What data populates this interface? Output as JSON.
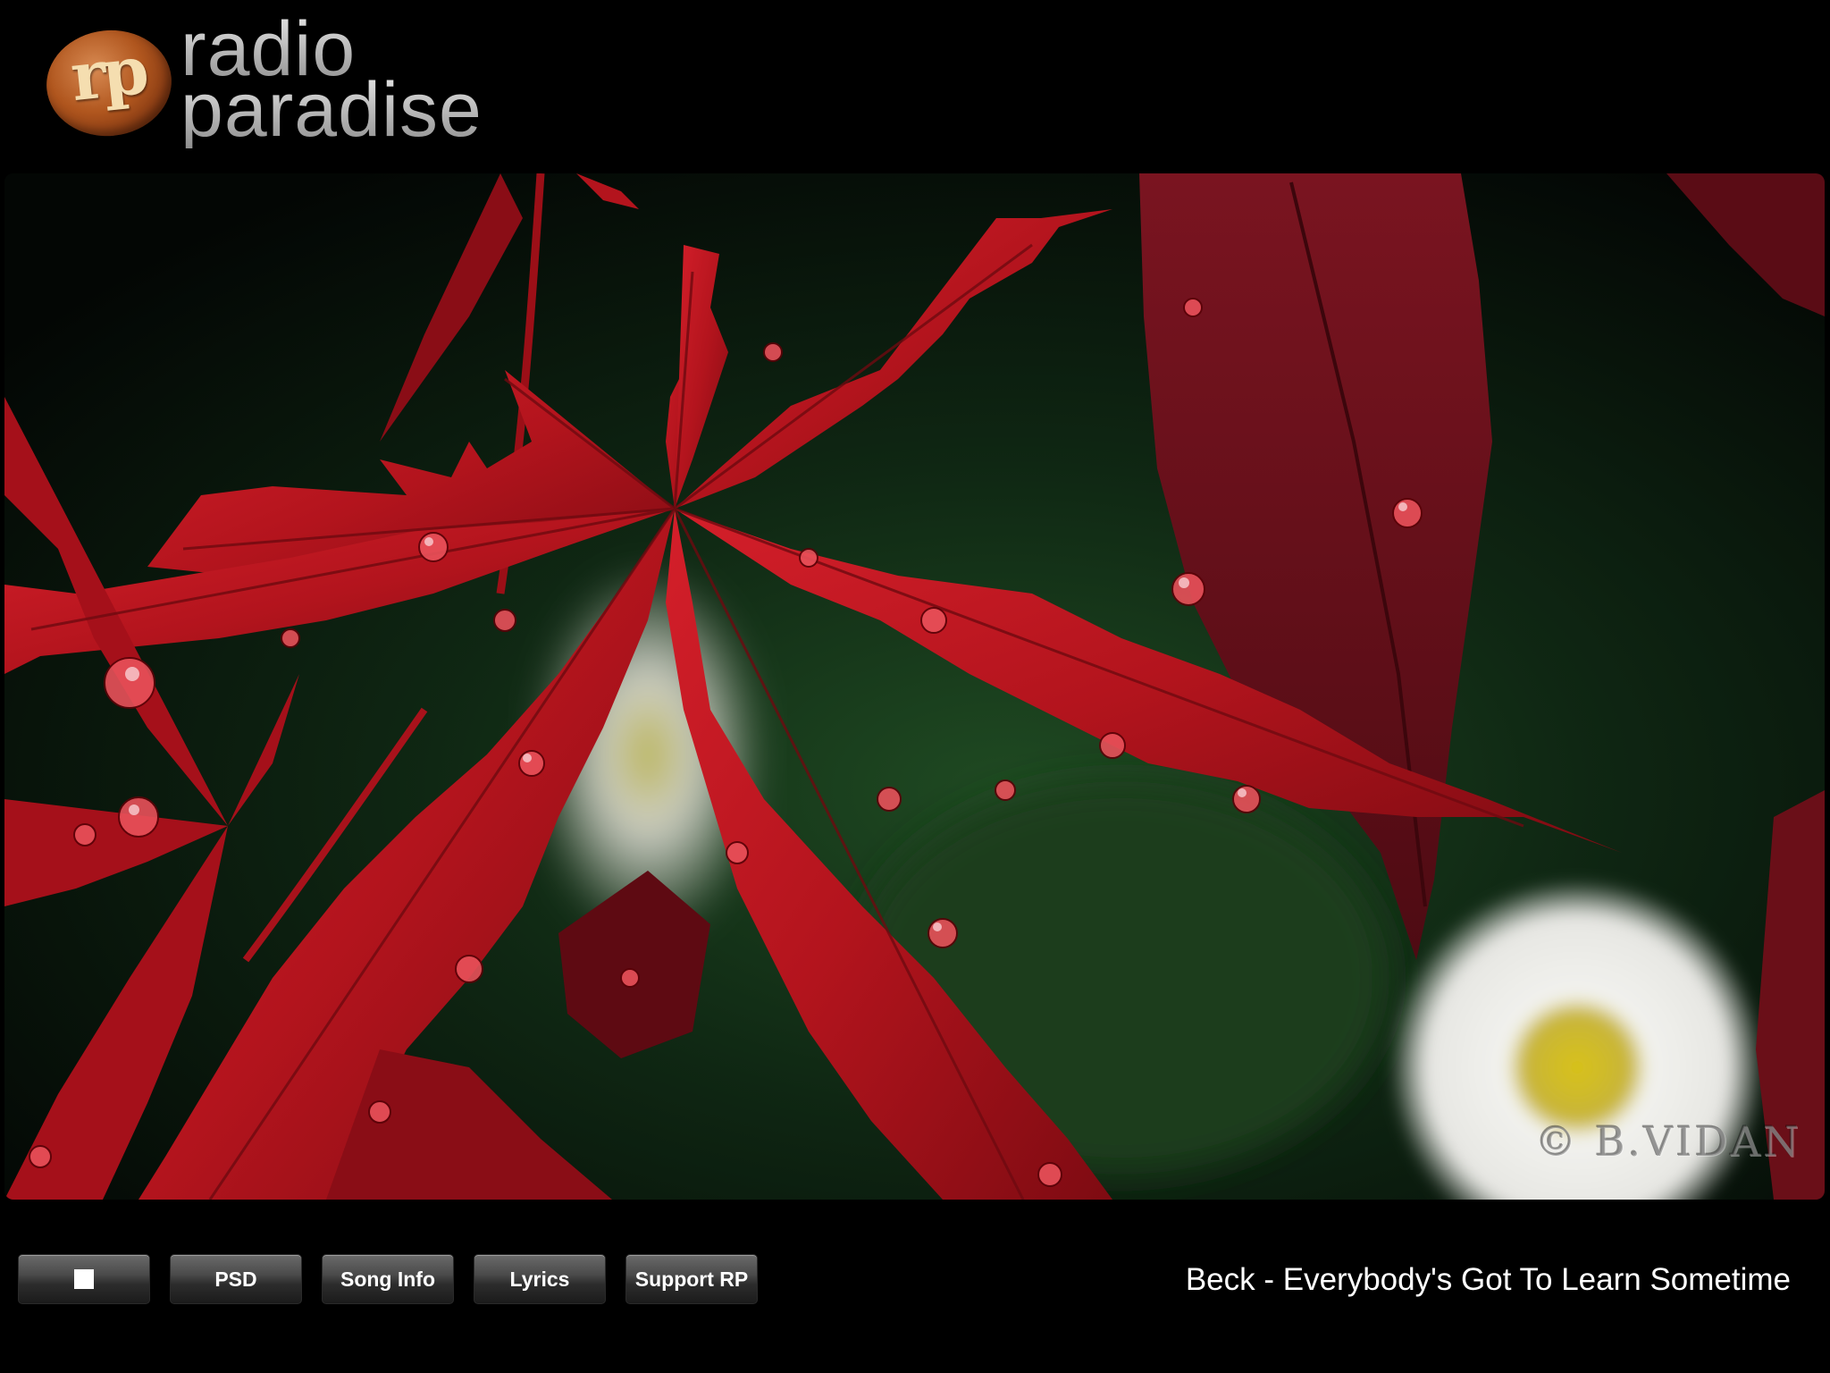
{
  "logo": {
    "badge": "rp",
    "line1": "radio",
    "line2": "paradise"
  },
  "artwork": {
    "watermark": "© B.VIDAN"
  },
  "controls": {
    "stop_icon": "stop-icon",
    "psd_label": "PSD",
    "song_info_label": "Song Info",
    "lyrics_label": "Lyrics",
    "support_label": "Support RP"
  },
  "now_playing": {
    "text": "Beck - Everybody's Got To Learn Sometime"
  },
  "colors": {
    "background": "#000000",
    "leaf_red": "#b3141d",
    "foliage_green": "#1f4a22",
    "button_text": "#ffffff"
  }
}
